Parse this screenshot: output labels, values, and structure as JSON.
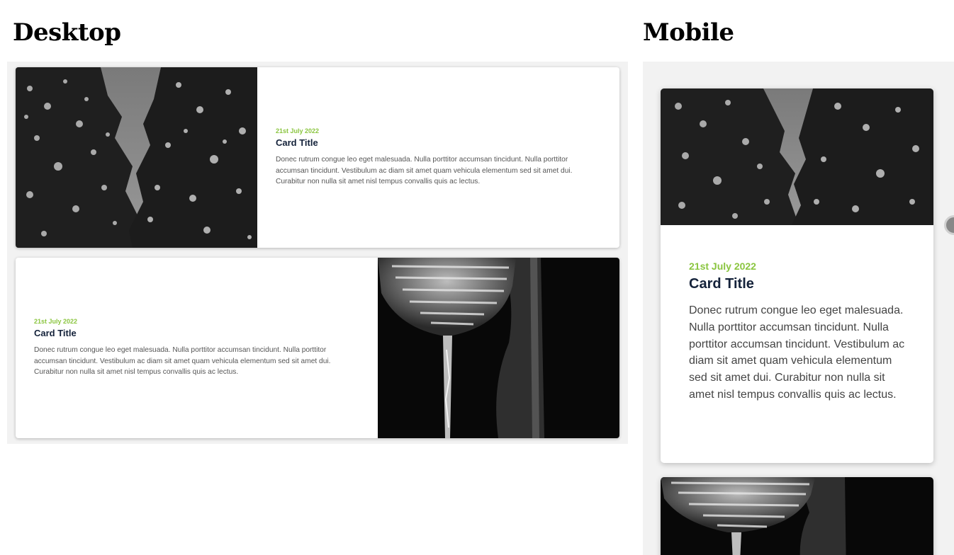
{
  "headings": {
    "desktop": "Desktop",
    "mobile": "Mobile"
  },
  "cards": [
    {
      "date": "21st July 2022",
      "title": "Card Title",
      "text": "Donec rutrum congue leo eget malesuada. Nulla porttitor accumsan tincidunt. Nulla porttitor accumsan tincidunt. Vestibulum ac diam sit amet quam vehicula elementum sed sit amet dui. Curabitur non nulla sit amet nisl tempus convallis quis ac lectus.",
      "image": "snowy-trees"
    },
    {
      "date": "21st July 2022",
      "title": "Card Title",
      "text": "Donec rutrum congue leo eget malesuada. Nulla porttitor accumsan tincidunt. Nulla porttitor accumsan tincidunt. Vestibulum ac diam sit amet quam vehicula elementum sed sit amet dui. Curabitur non nulla sit amet nisl tempus convallis quis ac lectus.",
      "image": "wine-glass"
    }
  ],
  "colors": {
    "accent": "#8ac53f",
    "title": "#14223a",
    "panel": "#f2f2f2"
  }
}
